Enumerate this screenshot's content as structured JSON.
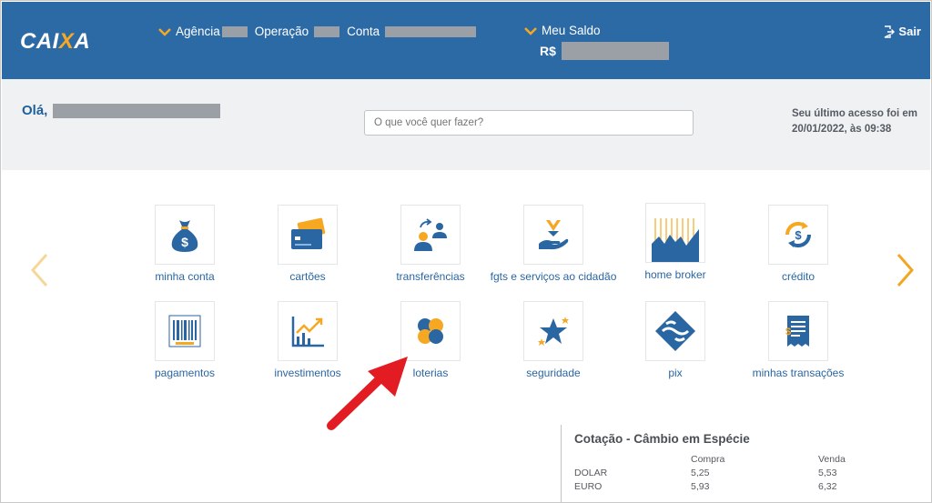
{
  "header": {
    "logo_text": "CAIXA",
    "agencia_label": "Agência",
    "operacao_label": "Operação",
    "conta_label": "Conta",
    "saldo_label": "Meu Saldo",
    "saldo_currency": "R$",
    "logout_label": "Sair",
    "bg_color": "#2c6aa6",
    "accent_color": "#f7a823"
  },
  "greeting": {
    "hello": "Olá,",
    "search_placeholder": "O que você quer fazer?",
    "last_access_line1": "Seu último acesso foi em",
    "last_access_line2": "20/01/2022, às 09:38"
  },
  "menu": [
    {
      "label": "minha conta",
      "icon": "money-bag-icon"
    },
    {
      "label": "cartões",
      "icon": "cards-icon"
    },
    {
      "label": "transferências",
      "icon": "transfer-icon"
    },
    {
      "label": "fgts e serviços ao cidadão",
      "icon": "fgts-hand-icon"
    },
    {
      "label": "home broker",
      "icon": "stock-chart-icon"
    },
    {
      "label": "crédito",
      "icon": "credit-cycle-icon"
    },
    {
      "label": "pagamentos",
      "icon": "barcode-icon"
    },
    {
      "label": "investimentos",
      "icon": "growth-chart-icon"
    },
    {
      "label": "loterias",
      "icon": "clover-icon"
    },
    {
      "label": "seguridade",
      "icon": "star-icon"
    },
    {
      "label": "pix",
      "icon": "pix-icon"
    },
    {
      "label": "minhas transações",
      "icon": "receipt-icon"
    }
  ],
  "cotacao": {
    "title": "Cotação - Câmbio em Espécie",
    "col_buy": "Compra",
    "col_sell": "Venda",
    "rows": [
      {
        "currency": "DOLAR",
        "buy": "5,25",
        "sell": "5,53"
      },
      {
        "currency": "EURO",
        "buy": "5,93",
        "sell": "6,32"
      }
    ]
  }
}
